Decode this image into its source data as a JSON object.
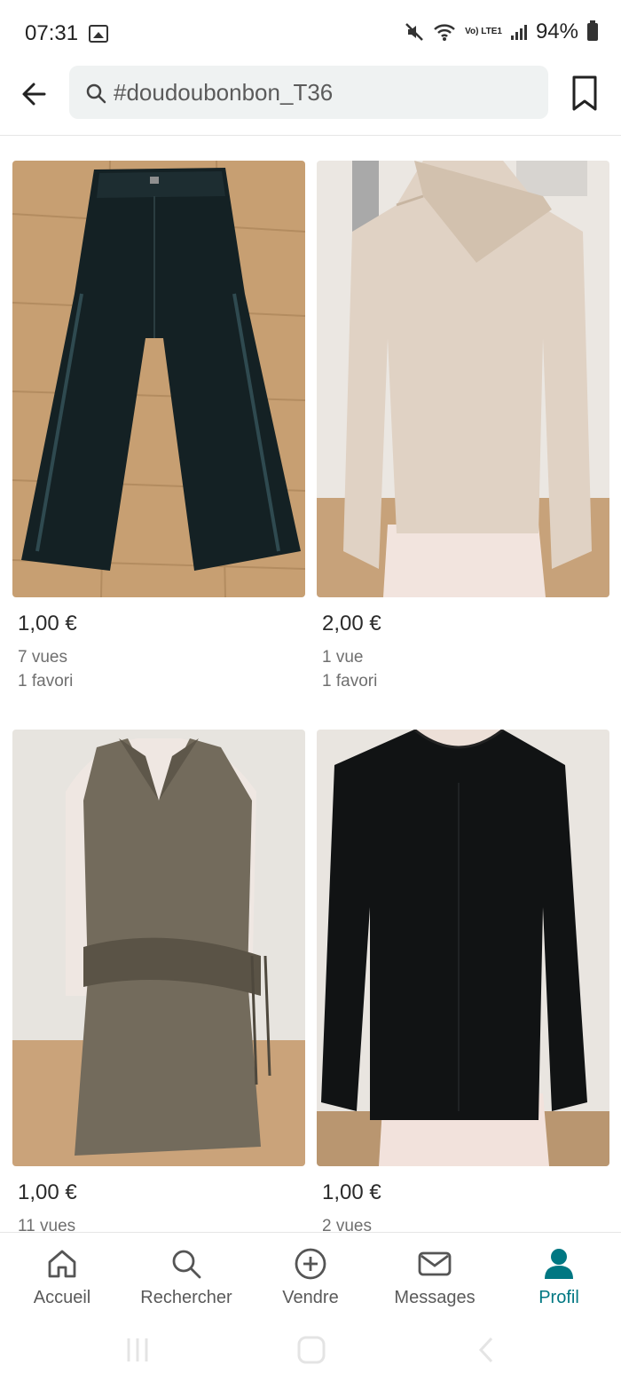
{
  "status_bar": {
    "time": "07:31",
    "battery": "94%",
    "network": "Vo) LTE1"
  },
  "header": {
    "search_query": "#doudoubonbon_T36"
  },
  "items": [
    {
      "price": "1,00 €",
      "views": "7 vues",
      "favorites": "1 favori",
      "image": "black-leather-pants"
    },
    {
      "price": "2,00 €",
      "views": "1 vue",
      "favorites": "1 favori",
      "image": "beige-sweater"
    },
    {
      "price": "1,00 €",
      "views": "11 vues",
      "image": "khaki-sleeveless-dress"
    },
    {
      "price": "1,00 €",
      "views": "2 vues",
      "image": "black-sweater"
    }
  ],
  "bottom_nav": [
    {
      "label": "Accueil",
      "icon": "home-icon"
    },
    {
      "label": "Rechercher",
      "icon": "search-icon"
    },
    {
      "label": "Vendre",
      "icon": "plus-circle-icon"
    },
    {
      "label": "Messages",
      "icon": "mail-icon"
    },
    {
      "label": "Profil",
      "icon": "profile-icon",
      "active": true
    }
  ],
  "colors": {
    "accent": "#007782",
    "search_bg": "#eff2f2"
  }
}
